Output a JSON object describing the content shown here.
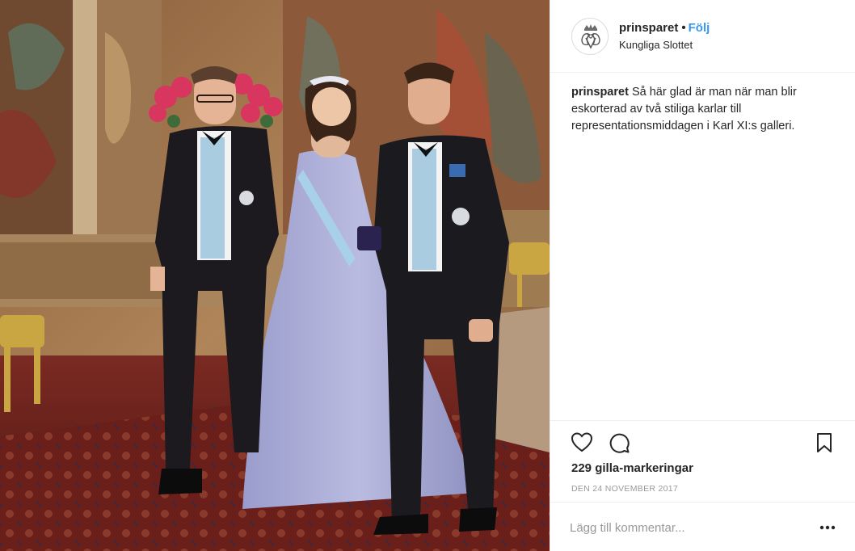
{
  "post": {
    "photo_alt": "",
    "author": {
      "username": "prinsparet",
      "separator": "•",
      "follow_label": "Följ",
      "location": "Kungliga Slottet",
      "avatar_icon": "royal-monogram-icon"
    },
    "caption": {
      "username": "prinsparet",
      "text": "Så här glad är man när man blir eskorterad av två stiliga karlar till representationsmiddagen i Karl XI:s galleri."
    },
    "actions": {
      "like_icon": "heart-icon",
      "comment_icon": "speech-bubble-icon",
      "save_icon": "bookmark-icon"
    },
    "likes_text": "229 gilla-markeringar",
    "date_text": "DEN 24 NOVEMBER 2017",
    "comment_box": {
      "placeholder": "Lägg till kommentar...",
      "value": "",
      "more_icon": "more-options-icon"
    }
  },
  "colors": {
    "link_blue": "#3897f0",
    "text": "#262626",
    "muted": "#999999",
    "divider": "#efefef"
  }
}
